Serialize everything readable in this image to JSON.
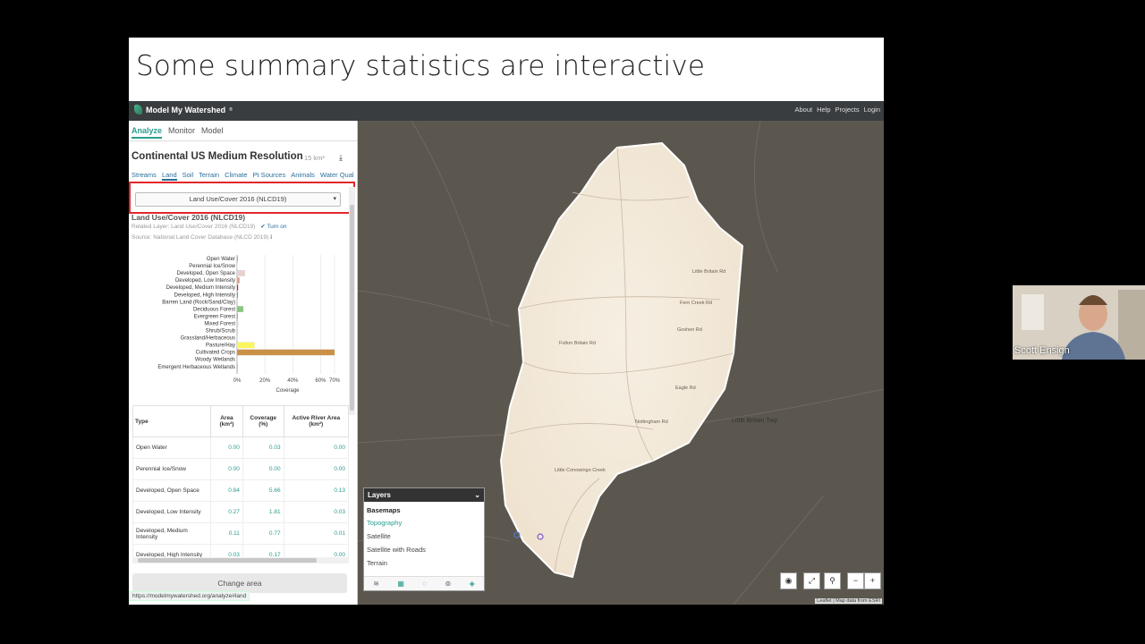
{
  "slide": {
    "title": "Some summary statistics are interactive"
  },
  "app": {
    "brand": "Model My Watershed",
    "brand_mark": "®",
    "nav": [
      "About",
      "Help",
      "Projects",
      "Login"
    ],
    "tabs": [
      "Analyze",
      "Monitor",
      "Model"
    ],
    "aoi_title": "Continental US Medium Resolution",
    "aoi_area": "15 km²",
    "subtabs": [
      "Streams",
      "Land",
      "Soil",
      "Terrain",
      "Climate",
      "Pt Sources",
      "Animals",
      "Water Qual"
    ],
    "dropdown_value": "Land Use/Cover 2016 (NLCD19)",
    "section_title": "Land Use/Cover 2016 (NLCD19)",
    "related_layer": "Related Layer: Land Use/Cover 2016 (NLCD19)",
    "turn_on": "✔ Turn on",
    "source": "Source: National Land Cover Database (NLCD 2019) ℹ",
    "change_area": "Change area",
    "status_url": "https://modelmywatershed.org/analyze#land"
  },
  "chart_data": {
    "type": "bar",
    "orientation": "horizontal",
    "categories": [
      "Open Water",
      "Perennial Ice/Snow",
      "Developed, Open Space",
      "Developed, Low Intensity",
      "Developed, Medium Intensity",
      "Developed, High Intensity",
      "Barren Land (Rock/Sand/Clay)",
      "Deciduous Forest",
      "Evergreen Forest",
      "Mixed Forest",
      "Shrub/Scrub",
      "Grassland/Herbaceous",
      "Pasture/Hay",
      "Cultivated Crops",
      "Woody Wetlands",
      "Emergent Herbaceous Wetlands"
    ],
    "values": [
      0.03,
      0.0,
      5.66,
      1.81,
      0.77,
      0.17,
      0.0,
      4.5,
      0.2,
      0.8,
      0.1,
      0.3,
      12.5,
      70.0,
      0.4,
      0.1
    ],
    "colors": [
      "#5475a8",
      "#ffffff",
      "#e8d1d1",
      "#e29e8c",
      "#ff0000",
      "#b50000",
      "#d2cdc0",
      "#85c77e",
      "#38814e",
      "#d4e7b0",
      "#dcca8f",
      "#fde9aa",
      "#fbf65d",
      "#ca9146",
      "#c8e6f8",
      "#64b3d5"
    ],
    "xlabel": "Coverage",
    "xticks": [
      "0%",
      "20%",
      "40%",
      "60%",
      "70%"
    ],
    "xlim": [
      0,
      70
    ],
    "grid": true
  },
  "table": {
    "headers": [
      "Type",
      "Area (km²)",
      "Coverage (%)",
      "Active River Area (km²)"
    ],
    "rows": [
      [
        "Open Water",
        "0.00",
        "0.03",
        "0.00"
      ],
      [
        "Perennial Ice/Snow",
        "0.00",
        "0.00",
        "0.00"
      ],
      [
        "Developed, Open Space",
        "0.84",
        "5.66",
        "0.13"
      ],
      [
        "Developed, Low Intensity",
        "0.27",
        "1.81",
        "0.03"
      ],
      [
        "Developed, Medium Intensity",
        "0.11",
        "0.77",
        "0.01"
      ],
      [
        "Developed, High Intensity",
        "0.03",
        "0.17",
        "0.00"
      ]
    ]
  },
  "map": {
    "layers_title": "Layers",
    "basemaps_label": "Basemaps",
    "basemaps": [
      "Topography",
      "Satellite",
      "Satellite with Roads",
      "Terrain"
    ],
    "selected_basemap": "Topography",
    "attribution": "Leaflet | Map data from ESRI",
    "place_label": "Little Britain Twp",
    "road_labels": [
      "Nottingham Rd",
      "Little Conowingo Creek",
      "Fulton Britain Rd",
      "Eagle Rd",
      "Goshen Rd",
      "Fern Creek Rd",
      "Little Britain Rd"
    ]
  },
  "webcam": {
    "name": "Scott Ensign"
  }
}
